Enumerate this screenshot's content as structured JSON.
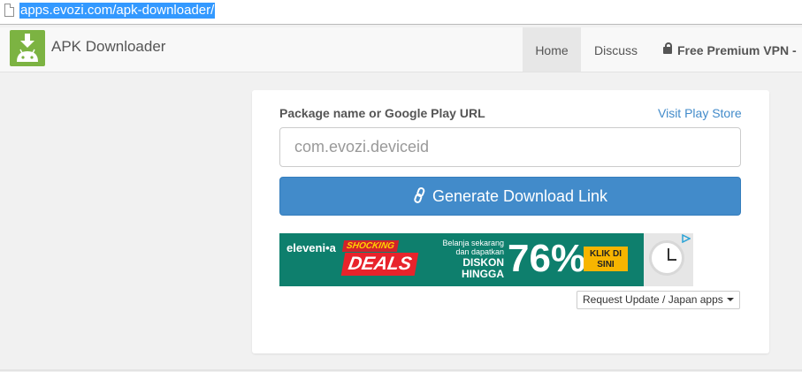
{
  "browser": {
    "url": "apps.evozi.com/apk-downloader/"
  },
  "navbar": {
    "brand": "APK Downloader",
    "items": [
      {
        "label": "Home",
        "active": true
      },
      {
        "label": "Discuss",
        "active": false
      },
      {
        "label": "Free Premium VPN -",
        "active": false
      }
    ]
  },
  "form": {
    "label": "Package name or Google Play URL",
    "visit_link": "Visit Play Store",
    "input_placeholder": "com.evozi.deviceid",
    "input_value": "",
    "generate_button": "Generate Download Link",
    "request_button": "Request Update / Japan apps"
  },
  "ad": {
    "brand": "eleveni•a",
    "deals_top": "SHOCKING",
    "deals": "DEALS",
    "small_text": "Belanja sekarang dan dapatkan",
    "big_text": "DISKON HINGGA",
    "percent": "76%",
    "cta": "KLIK DI SINI"
  },
  "colors": {
    "primary": "#428bca",
    "nav_active_bg": "#e7e7e7",
    "logo_green": "#7cb342",
    "url_highlight": "#3399ff"
  },
  "icons": {
    "url": "document-icon",
    "logo": "android-download-icon",
    "vpn": "lock-icon",
    "generate": "link-icon",
    "request": "caret-down-icon"
  }
}
